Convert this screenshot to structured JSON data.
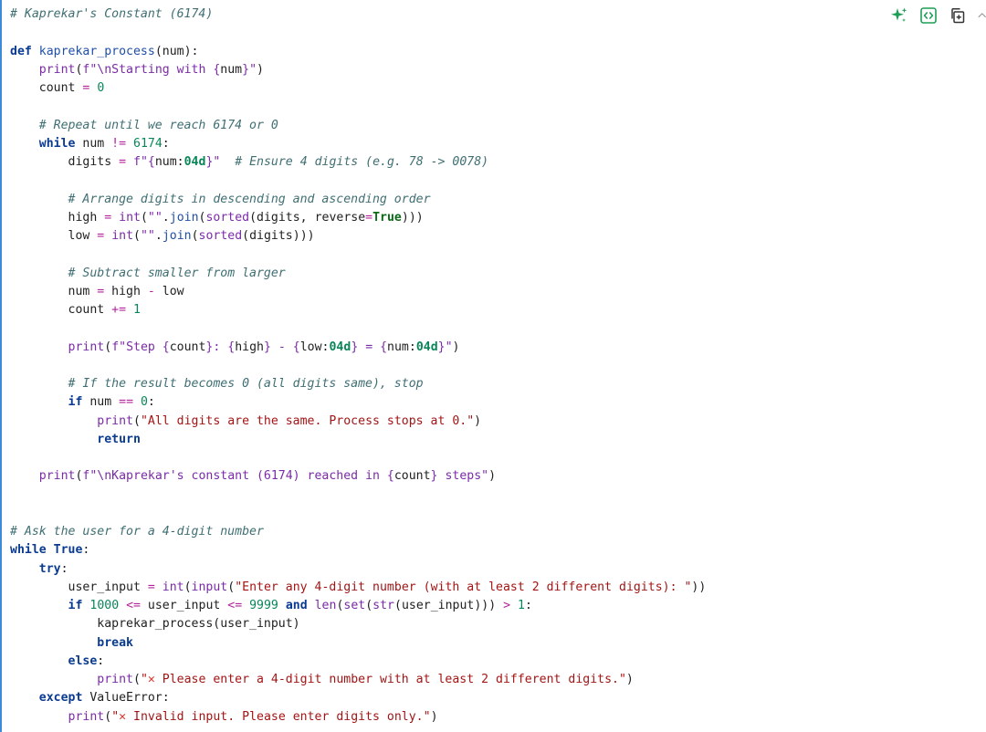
{
  "toolbar": {
    "icons": [
      "sparkle-icon",
      "code-brackets-icon",
      "copy-icon",
      "chevron-up-icon"
    ],
    "accent": "#1f9e57",
    "border_color": "#3f8ad8"
  },
  "code": {
    "lines": [
      [
        {
          "t": "# Kaprekar's Constant (6174)",
          "c": "com"
        }
      ],
      [],
      [
        {
          "t": "def",
          "c": "def"
        },
        {
          "t": " "
        },
        {
          "t": "kaprekar_process",
          "c": "fnname"
        },
        {
          "t": "(num):"
        }
      ],
      [
        {
          "t": "    "
        },
        {
          "t": "print",
          "c": "bi"
        },
        {
          "t": "("
        },
        {
          "t": "f\"\\nStarting with ",
          "c": "str"
        },
        {
          "t": "{",
          "c": "brace"
        },
        {
          "t": "num"
        },
        {
          "t": "}",
          "c": "brace"
        },
        {
          "t": "\"",
          "c": "str"
        },
        {
          "t": ")"
        }
      ],
      [
        {
          "t": "    count "
        },
        {
          "t": "=",
          "c": "op"
        },
        {
          "t": " "
        },
        {
          "t": "0",
          "c": "num"
        }
      ],
      [],
      [
        {
          "t": "    "
        },
        {
          "t": "# Repeat until we reach 6174 or 0",
          "c": "com"
        }
      ],
      [
        {
          "t": "    "
        },
        {
          "t": "while",
          "c": "kw"
        },
        {
          "t": " num "
        },
        {
          "t": "!=",
          "c": "op"
        },
        {
          "t": " "
        },
        {
          "t": "6174",
          "c": "num"
        },
        {
          "t": ":"
        }
      ],
      [
        {
          "t": "        digits "
        },
        {
          "t": "=",
          "c": "op"
        },
        {
          "t": " "
        },
        {
          "t": "f\"",
          "c": "str"
        },
        {
          "t": "{",
          "c": "brace"
        },
        {
          "t": "num:"
        },
        {
          "t": "04d",
          "c": "fmt"
        },
        {
          "t": "}",
          "c": "brace"
        },
        {
          "t": "\"",
          "c": "str"
        },
        {
          "t": "  "
        },
        {
          "t": "# Ensure 4 digits (e.g. 78 -> 0078)",
          "c": "com"
        }
      ],
      [],
      [
        {
          "t": "        "
        },
        {
          "t": "# Arrange digits in descending and ascending order",
          "c": "com"
        }
      ],
      [
        {
          "t": "        high "
        },
        {
          "t": "=",
          "c": "op"
        },
        {
          "t": " "
        },
        {
          "t": "int",
          "c": "bi"
        },
        {
          "t": "("
        },
        {
          "t": "\"\"",
          "c": "str"
        },
        {
          "t": "."
        },
        {
          "t": "join",
          "c": "fnname"
        },
        {
          "t": "("
        },
        {
          "t": "sorted",
          "c": "bi"
        },
        {
          "t": "(digits, reverse"
        },
        {
          "t": "=",
          "c": "op"
        },
        {
          "t": "True",
          "c": "true"
        },
        {
          "t": ")))"
        }
      ],
      [
        {
          "t": "        low "
        },
        {
          "t": "=",
          "c": "op"
        },
        {
          "t": " "
        },
        {
          "t": "int",
          "c": "bi"
        },
        {
          "t": "("
        },
        {
          "t": "\"\"",
          "c": "str"
        },
        {
          "t": "."
        },
        {
          "t": "join",
          "c": "fnname"
        },
        {
          "t": "("
        },
        {
          "t": "sorted",
          "c": "bi"
        },
        {
          "t": "(digits)))"
        }
      ],
      [],
      [
        {
          "t": "        "
        },
        {
          "t": "# Subtract smaller from larger",
          "c": "com"
        }
      ],
      [
        {
          "t": "        num "
        },
        {
          "t": "=",
          "c": "op"
        },
        {
          "t": " high "
        },
        {
          "t": "-",
          "c": "op"
        },
        {
          "t": " low"
        }
      ],
      [
        {
          "t": "        count "
        },
        {
          "t": "+=",
          "c": "op"
        },
        {
          "t": " "
        },
        {
          "t": "1",
          "c": "num"
        }
      ],
      [],
      [
        {
          "t": "        "
        },
        {
          "t": "print",
          "c": "bi"
        },
        {
          "t": "("
        },
        {
          "t": "f\"Step ",
          "c": "str"
        },
        {
          "t": "{",
          "c": "brace"
        },
        {
          "t": "count"
        },
        {
          "t": "}",
          "c": "brace"
        },
        {
          "t": ": ",
          "c": "str"
        },
        {
          "t": "{",
          "c": "brace"
        },
        {
          "t": "high"
        },
        {
          "t": "}",
          "c": "brace"
        },
        {
          "t": " - ",
          "c": "str"
        },
        {
          "t": "{",
          "c": "brace"
        },
        {
          "t": "low:"
        },
        {
          "t": "04d",
          "c": "fmt"
        },
        {
          "t": "}",
          "c": "brace"
        },
        {
          "t": " = ",
          "c": "str"
        },
        {
          "t": "{",
          "c": "brace"
        },
        {
          "t": "num:"
        },
        {
          "t": "04d",
          "c": "fmt"
        },
        {
          "t": "}",
          "c": "brace"
        },
        {
          "t": "\"",
          "c": "str"
        },
        {
          "t": ")"
        }
      ],
      [],
      [
        {
          "t": "        "
        },
        {
          "t": "# If the result becomes 0 (all digits same), stop",
          "c": "com"
        }
      ],
      [
        {
          "t": "        "
        },
        {
          "t": "if",
          "c": "kw"
        },
        {
          "t": " num "
        },
        {
          "t": "==",
          "c": "op"
        },
        {
          "t": " "
        },
        {
          "t": "0",
          "c": "num"
        },
        {
          "t": ":"
        }
      ],
      [
        {
          "t": "            "
        },
        {
          "t": "print",
          "c": "bi"
        },
        {
          "t": "("
        },
        {
          "t": "\"All digits are the same. Process stops at 0.\"",
          "c": "strred"
        },
        {
          "t": ")"
        }
      ],
      [
        {
          "t": "            "
        },
        {
          "t": "return",
          "c": "kw"
        }
      ],
      [],
      [
        {
          "t": "    "
        },
        {
          "t": "print",
          "c": "bi"
        },
        {
          "t": "("
        },
        {
          "t": "f\"\\nKaprekar's constant (6174) reached in ",
          "c": "str"
        },
        {
          "t": "{",
          "c": "brace"
        },
        {
          "t": "count"
        },
        {
          "t": "}",
          "c": "brace"
        },
        {
          "t": " steps\"",
          "c": "str"
        },
        {
          "t": ")"
        }
      ],
      [],
      [],
      [
        {
          "t": "# Ask the user for a 4-digit number",
          "c": "com"
        }
      ],
      [
        {
          "t": "while",
          "c": "kw"
        },
        {
          "t": " "
        },
        {
          "t": "True",
          "c": "kw"
        },
        {
          "t": ":"
        }
      ],
      [
        {
          "t": "    "
        },
        {
          "t": "try",
          "c": "kw"
        },
        {
          "t": ":"
        }
      ],
      [
        {
          "t": "        user_input "
        },
        {
          "t": "=",
          "c": "op"
        },
        {
          "t": " "
        },
        {
          "t": "int",
          "c": "bi"
        },
        {
          "t": "("
        },
        {
          "t": "input",
          "c": "bi"
        },
        {
          "t": "("
        },
        {
          "t": "\"Enter any 4-digit number (with at least 2 different digits): \"",
          "c": "strred"
        },
        {
          "t": "))"
        }
      ],
      [
        {
          "t": "        "
        },
        {
          "t": "if",
          "c": "kw"
        },
        {
          "t": " "
        },
        {
          "t": "1000",
          "c": "num"
        },
        {
          "t": " "
        },
        {
          "t": "<=",
          "c": "op"
        },
        {
          "t": " user_input "
        },
        {
          "t": "<=",
          "c": "op"
        },
        {
          "t": " "
        },
        {
          "t": "9999",
          "c": "num"
        },
        {
          "t": " "
        },
        {
          "t": "and",
          "c": "kw"
        },
        {
          "t": " "
        },
        {
          "t": "len",
          "c": "bi"
        },
        {
          "t": "("
        },
        {
          "t": "set",
          "c": "bi"
        },
        {
          "t": "("
        },
        {
          "t": "str",
          "c": "bi"
        },
        {
          "t": "(user_input))) "
        },
        {
          "t": ">",
          "c": "op"
        },
        {
          "t": " "
        },
        {
          "t": "1",
          "c": "num"
        },
        {
          "t": ":"
        }
      ],
      [
        {
          "t": "            kaprekar_process(user_input)"
        }
      ],
      [
        {
          "t": "            "
        },
        {
          "t": "break",
          "c": "kw"
        }
      ],
      [
        {
          "t": "        "
        },
        {
          "t": "else",
          "c": "kw"
        },
        {
          "t": ":"
        }
      ],
      [
        {
          "t": "            "
        },
        {
          "t": "print",
          "c": "bi"
        },
        {
          "t": "("
        },
        {
          "t": "\"",
          "c": "strred"
        },
        {
          "t": "✕",
          "c": "cross"
        },
        {
          "t": " Please enter a 4-digit number with at least 2 different digits.\"",
          "c": "strred"
        },
        {
          "t": ")"
        }
      ],
      [
        {
          "t": "    "
        },
        {
          "t": "except",
          "c": "kw"
        },
        {
          "t": " ValueError:"
        }
      ],
      [
        {
          "t": "        "
        },
        {
          "t": "print",
          "c": "bi"
        },
        {
          "t": "("
        },
        {
          "t": "\"",
          "c": "strred"
        },
        {
          "t": "✕",
          "c": "cross"
        },
        {
          "t": " Invalid input. Please enter digits only.\"",
          "c": "strred"
        },
        {
          "t": ")"
        }
      ]
    ]
  }
}
